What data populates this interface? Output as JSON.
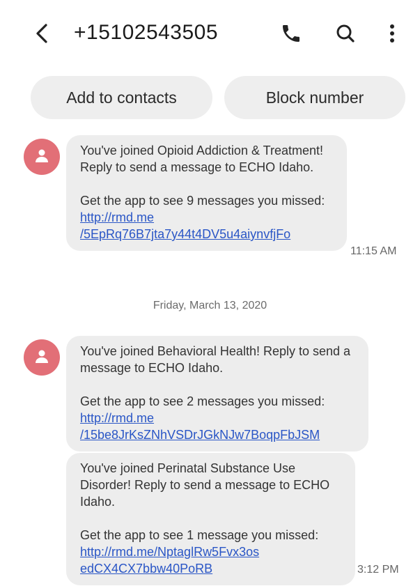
{
  "header": {
    "title": "+15102543505",
    "back_icon": "back-arrow-icon",
    "call_icon": "phone-icon",
    "search_icon": "search-icon",
    "menu_icon": "more-vert-icon"
  },
  "actions": {
    "add_contacts": "Add to contacts",
    "block_number": "Block number"
  },
  "messages": [
    {
      "text1": "You've joined Opioid Addiction & Treatment! Reply to send a message to ECHO Idaho.",
      "text2": "Get the app to see 9 messages you missed: ",
      "link": "http://rmd.me /5EpRq76B7jta7y44t4DV5u4aiynvfjFo",
      "time": "11:15 AM"
    },
    {
      "text1": "You've joined Behavioral Health! Reply to send a message to ECHO Idaho.",
      "text2": "Get the app to see 2 messages you missed: ",
      "link": "http://rmd.me /15be8JrKsZNhVSDrJGkNJw7BoqpFbJSM"
    },
    {
      "text1": "You've joined Perinatal Substance Use Disorder! Reply to send a message to ECHO Idaho.",
      "text2": "Get the app to see 1 message you missed: ",
      "link": "http://rmd.me/NptaglRw5Fvx3os edCX4CX7bbw40PoRB",
      "time": "3:12 PM"
    }
  ],
  "date_separator": "Friday, March 13, 2020",
  "colors": {
    "avatar": "#e26f77",
    "bubble": "#ededed",
    "link": "#2a56c6"
  }
}
